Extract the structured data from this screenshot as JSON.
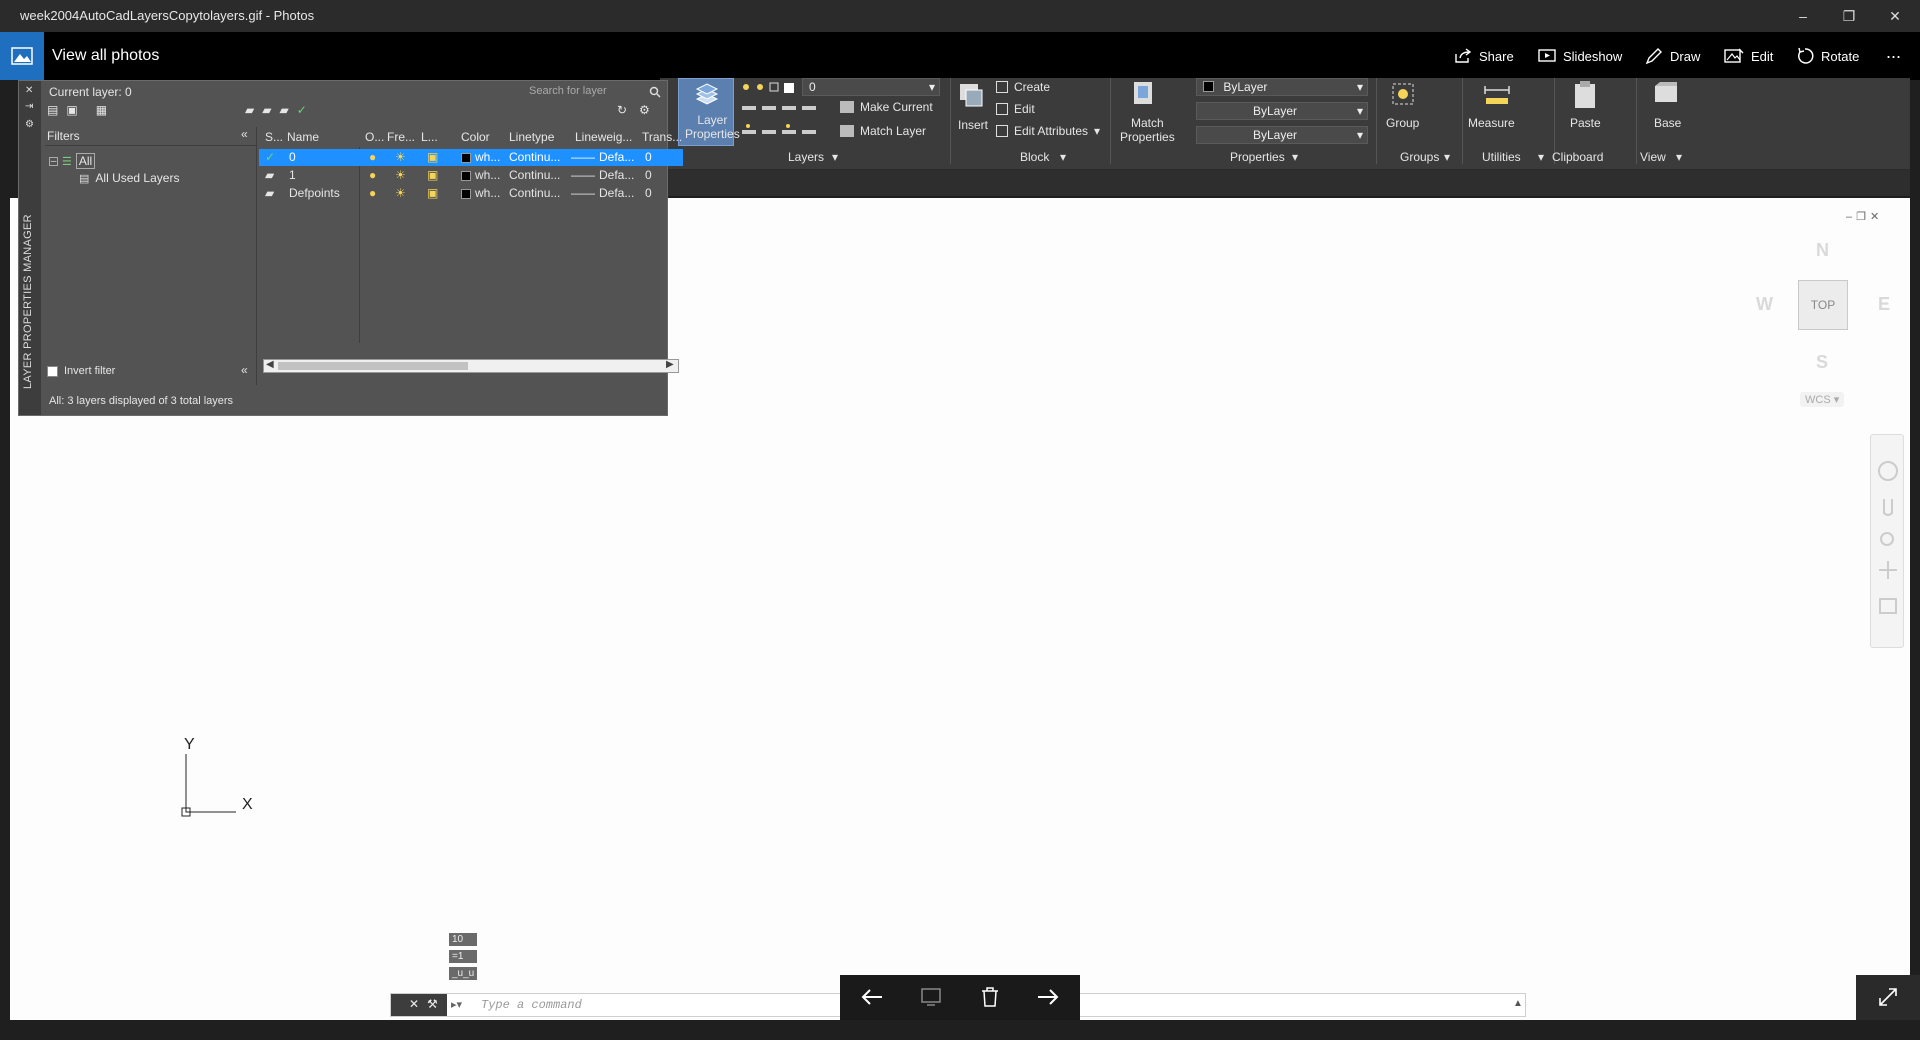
{
  "window": {
    "title": "week2004AutoCadLayersCopytolayers.gif - Photos",
    "controls": [
      "minimize",
      "restore",
      "close"
    ]
  },
  "photos_bar": {
    "view_all": "View all photos",
    "actions": [
      {
        "label": "Share",
        "icon": "share-icon"
      },
      {
        "label": "Slideshow",
        "icon": "slideshow-icon"
      },
      {
        "label": "Draw",
        "icon": "draw-icon"
      },
      {
        "label": "Edit",
        "icon": "edit-icon"
      },
      {
        "label": "Rotate",
        "icon": "rotate-icon"
      }
    ],
    "more": "..."
  },
  "ribbon": {
    "layer_properties": "Layer\nProperties",
    "layer_dropdown": "0",
    "make_current": "Make Current",
    "match_layer": "Match Layer",
    "layers_panel": "Layers",
    "insert": "Insert",
    "create": "Create",
    "edit": "Edit",
    "edit_attributes": "Edit Attributes",
    "block_panel": "Block",
    "match_properties": "Match\nProperties",
    "prop_color": "ByLayer",
    "prop_linetype": "ByLayer",
    "prop_lineweight": "ByLayer",
    "properties_panel": "Properties",
    "group": "Group",
    "groups_panel": "Groups",
    "measure": "Measure",
    "utilities_panel": "Utilities",
    "paste": "Paste",
    "clipboard_panel": "Clipboard",
    "base": "Base",
    "view_panel": "View"
  },
  "layer_manager": {
    "side_title": "LAYER PROPERTIES MANAGER",
    "current_layer": "Current layer: 0",
    "search_placeholder": "Search for layer",
    "filters_label": "Filters",
    "filter_tree": {
      "root": "All",
      "child": "All Used Layers"
    },
    "invert_filter": "Invert filter",
    "status": "All: 3 layers displayed of 3 total layers",
    "columns": [
      "S...",
      "Name",
      "O...",
      "Fre...",
      "L...",
      "Color",
      "Linetype",
      "Lineweig...",
      "Trans..."
    ],
    "layers": [
      {
        "name": "0",
        "color": "wh...",
        "linetype": "Continu...",
        "lineweight": "Defa...",
        "transparency": "0",
        "selected": true
      },
      {
        "name": "1",
        "color": "wh...",
        "linetype": "Continu...",
        "lineweight": "Defa...",
        "transparency": "0",
        "selected": false
      },
      {
        "name": "Defpoints",
        "color": "wh...",
        "linetype": "Continu...",
        "lineweight": "Defa...",
        "transparency": "0",
        "selected": false
      }
    ]
  },
  "viewcube": {
    "north": "N",
    "south": "S",
    "east": "E",
    "west": "W",
    "face": "TOP",
    "wcs": "WCS"
  },
  "ucs": {
    "x": "X",
    "y": "Y"
  },
  "command_line": {
    "placeholder": "Type a command",
    "history_tags": [
      "10",
      "=1",
      "_u_u"
    ]
  },
  "colors": {
    "accent": "#1e90ff",
    "photos_blue": "#1f6fc0",
    "ribbon_bg": "#3b3b3b",
    "panel_bg": "#535353"
  }
}
